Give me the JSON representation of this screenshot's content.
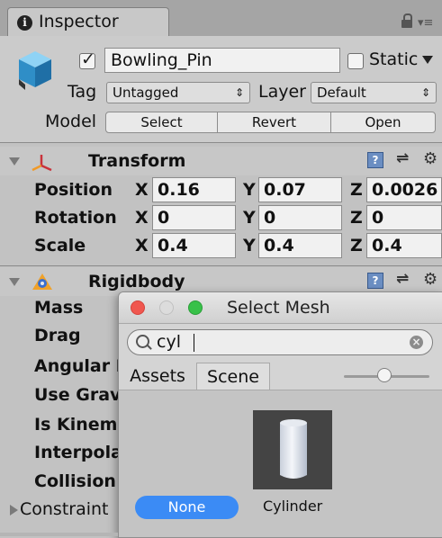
{
  "tab": {
    "title": "Inspector"
  },
  "header": {
    "object_name": "Bowling_Pin",
    "static_label": "Static",
    "tag_label": "Tag",
    "tag_value": "Untagged",
    "layer_label": "Layer",
    "layer_value": "Default",
    "model_label": "Model",
    "model_buttons": [
      "Select",
      "Revert",
      "Open"
    ]
  },
  "transform": {
    "title": "Transform",
    "rows": [
      {
        "label": "Position",
        "x": "0.16",
        "y": "0.07",
        "z": "0.0026"
      },
      {
        "label": "Rotation",
        "x": "0",
        "y": "0",
        "z": "0"
      },
      {
        "label": "Scale",
        "x": "0.4",
        "y": "0.4",
        "z": "0.4"
      }
    ],
    "axes": [
      "X",
      "Y",
      "Z"
    ]
  },
  "rigidbody": {
    "title": "Rigidbody",
    "rows": [
      "Mass",
      "Drag",
      "Angular D",
      "Use Gravi",
      "Is Kinema",
      "Interpolat",
      "Collision",
      "Constraint"
    ]
  },
  "select_mesh": {
    "title": "Select Mesh",
    "search_value": "cyl",
    "tabs": [
      "Assets",
      "Scene"
    ],
    "none_label": "None",
    "item_label": "Cylinder"
  }
}
